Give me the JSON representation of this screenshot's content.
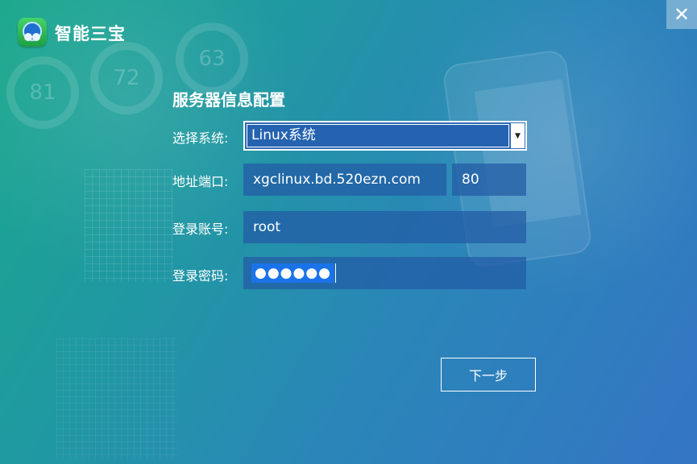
{
  "window": {
    "app_title": "智能三宝",
    "close_icon": "close-icon",
    "logo_icon": "app-logo-icon"
  },
  "background": {
    "dial_numbers": [
      "81",
      "72",
      "63"
    ]
  },
  "form": {
    "title": "服务器信息配置",
    "system_label": "选择系统:",
    "system_value": "Linux系统",
    "address_label": "地址端口:",
    "address_value": "xgclinux.bd.520ezn.com",
    "port_value": "80",
    "account_label": "登录账号:",
    "account_value": "root",
    "password_label": "登录密码:",
    "password_value": "●●●●●●"
  },
  "actions": {
    "next_label": "下一步"
  }
}
